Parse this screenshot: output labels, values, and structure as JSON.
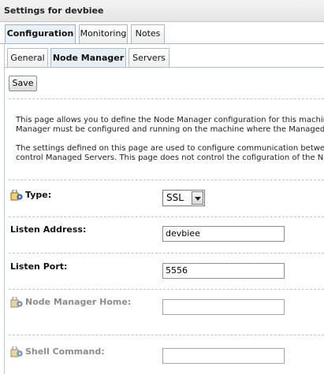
{
  "window": {
    "title": "Settings for devbiee"
  },
  "tabs": [
    {
      "label": "Configuration",
      "active": true
    },
    {
      "label": "Monitoring",
      "active": false
    },
    {
      "label": "Notes",
      "active": false
    }
  ],
  "subtabs": [
    {
      "label": "General",
      "active": false
    },
    {
      "label": "Node Manager",
      "active": true
    },
    {
      "label": "Servers",
      "active": false
    }
  ],
  "toolbar": {
    "save_label": "Save"
  },
  "description": {
    "line1": "This page allows you to define the Node Manager configuration for this machine. T",
    "line2": "Manager must be configured and running on the machine where the Managed Serv",
    "line3": "The settings defined on this page are used to configure communication between t",
    "line4": "control Managed Servers. This page does not control the cofiguration of the Node"
  },
  "fields": {
    "type": {
      "label": "Type:",
      "value": "SSL",
      "icon": "config-change-icon"
    },
    "listen_address": {
      "label": "Listen Address:",
      "value": "devbiee"
    },
    "listen_port": {
      "label": "Listen Port:",
      "value": "5556"
    },
    "node_manager_home": {
      "label": "Node Manager Home:",
      "value": "",
      "disabled": true,
      "icon": "config-change-icon"
    },
    "shell_command": {
      "label": "Shell Command:",
      "value": "",
      "disabled": true,
      "icon": "config-change-icon"
    }
  },
  "colors": {
    "tab_border": "#a9b6c3",
    "active_tab": "#e9f1f7",
    "disabled_text": "#8c8c8c"
  }
}
